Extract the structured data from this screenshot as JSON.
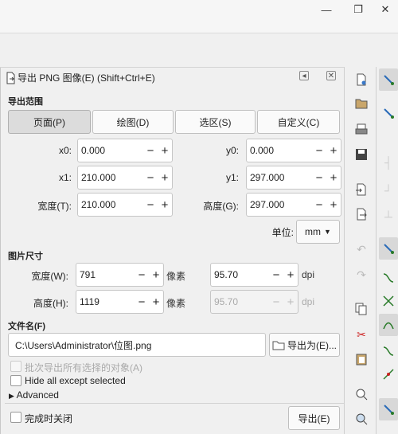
{
  "window": {
    "minimize_glyph": "—",
    "restore_glyph": "❐",
    "close_glyph": "✕"
  },
  "dock": {
    "title": "导出 PNG 图像(E) (Shift+Ctrl+E)",
    "collapse_glyph": "◂",
    "close_glyph": "✕"
  },
  "export_area": {
    "heading": "导出范围",
    "tabs": [
      "页面(P)",
      "绘图(D)",
      "选区(S)",
      "自定义(C)"
    ],
    "x0": {
      "label": "x0:",
      "value": "0.000"
    },
    "y0": {
      "label": "y0:",
      "value": "0.000"
    },
    "x1": {
      "label": "x1:",
      "value": "210.000"
    },
    "y1": {
      "label": "y1:",
      "value": "297.000"
    },
    "width": {
      "label": "宽度(T):",
      "value": "210.000"
    },
    "height": {
      "label": "高度(G):",
      "value": "297.000"
    },
    "units_label": "单位:",
    "units_value": "mm"
  },
  "image_size": {
    "heading": "图片尺寸",
    "width": {
      "label": "宽度(W):",
      "value": "791",
      "unit": "像素"
    },
    "height": {
      "label": "高度(H):",
      "value": "1119",
      "unit": "像素"
    },
    "dpi_x": {
      "value": "95.70",
      "unit": "dpi"
    },
    "dpi_y": {
      "value": "95.70",
      "unit": "dpi"
    }
  },
  "filename": {
    "heading": "文件名(F)",
    "value": "C:\\Users\\Administrator\\位图.png",
    "export_as_label": "导出为(E)..."
  },
  "options": {
    "batch_export": "批次导出所有选择的对象(A)",
    "hide_all": "Hide all except selected",
    "advanced": "Advanced"
  },
  "footer": {
    "close_when_done": "完成时关闭",
    "export_label": "导出(E)"
  },
  "plus_glyph": "+",
  "minus_glyph": "−"
}
